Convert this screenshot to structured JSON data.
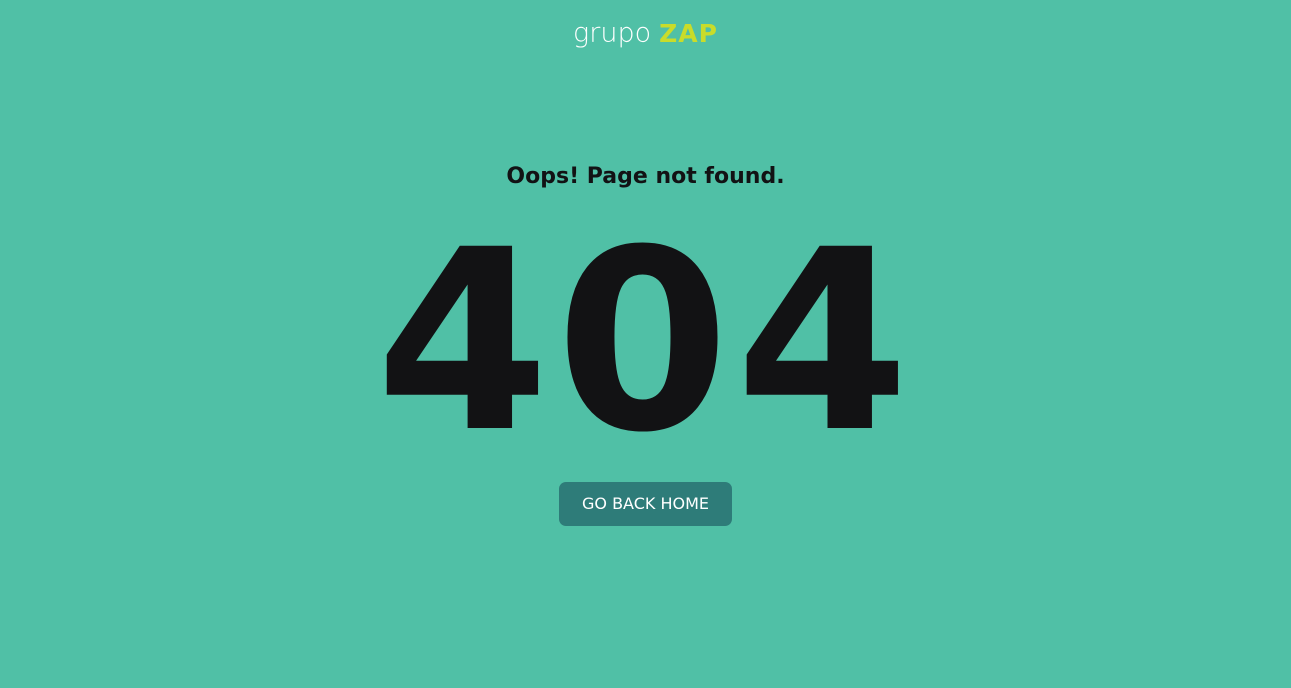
{
  "logo": {
    "text_grupo": "grupo",
    "text_zap": "ZAP"
  },
  "heading": "Oops! Page not found.",
  "error_code": "404",
  "button": {
    "label": "GO BACK HOME"
  },
  "colors": {
    "background": "#50c0a6",
    "button": "#2e7c79",
    "zap_accent": "#c9dc2a",
    "text_dark": "#121214"
  }
}
